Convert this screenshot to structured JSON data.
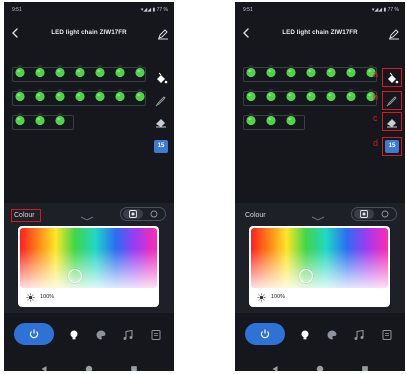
{
  "status": {
    "time": "9:51",
    "system": "▾◢◢ ▮ 77 %"
  },
  "app": {
    "title": "LED light chain ZIW17FR"
  },
  "lights": {
    "bulb_color": "#4fd34a",
    "rows": [
      7,
      7,
      3
    ]
  },
  "tools": {
    "badge_number": "15"
  },
  "annotations": {
    "labels": [
      "a",
      "b",
      "c",
      "d"
    ],
    "color": "#d7191f"
  },
  "panel": {
    "section_label": "Colour",
    "brightness": "100%"
  },
  "picker": {
    "selected_hue_fraction": 0.4,
    "selected_saturation_fraction": 0.8
  },
  "colors": {
    "background": "#15171c",
    "sheet": "#1d2027",
    "accent": "#2f72d6"
  }
}
